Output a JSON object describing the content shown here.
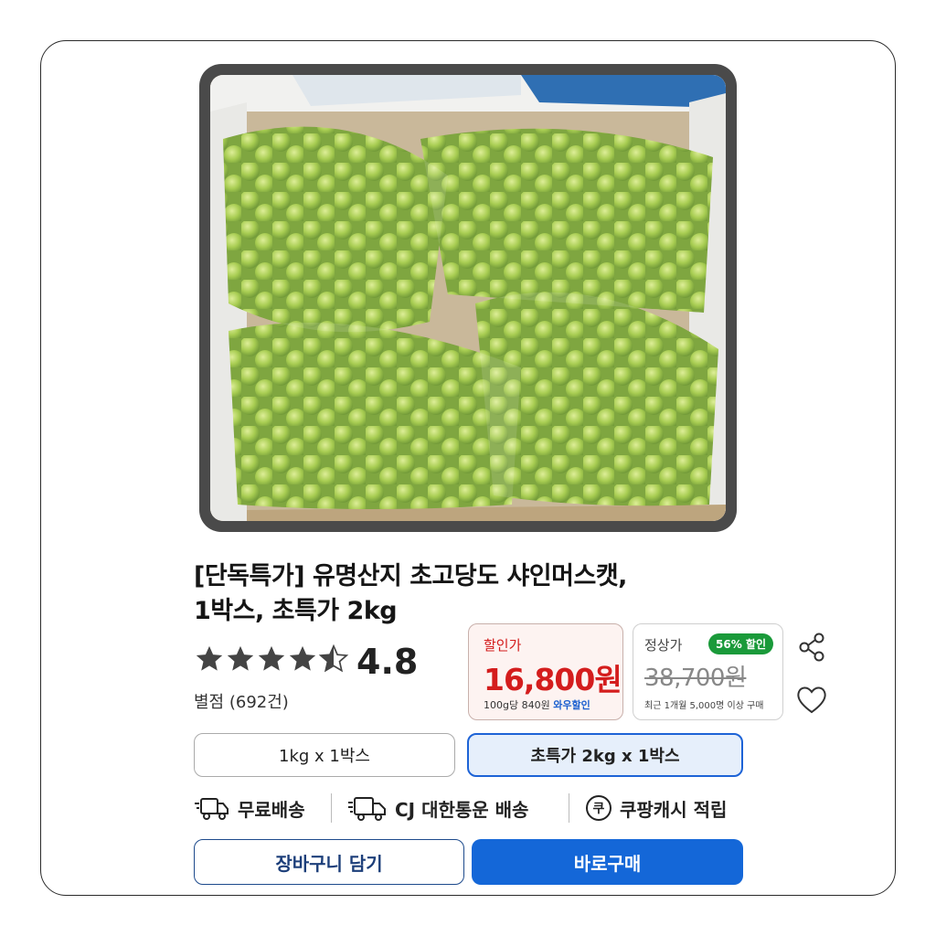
{
  "product": {
    "image_alt": "샤인머스캣 포도 박스",
    "title_line1": "[단독특가] 유명산지 초고당도 샤인머스캣,",
    "title_line2": "1박스, 초특가 2kg"
  },
  "rating": {
    "value": "4.8",
    "stars": 4.5,
    "review_count": "별점 (692건)"
  },
  "price": {
    "label": "할인가",
    "value": "16,800원",
    "unit_price": "100g당 840원",
    "wow": "와우할인",
    "accent_color": "#d41d1d"
  },
  "regular": {
    "label": "정상가",
    "badge": "56% 할인",
    "value": "38,700원",
    "note": "최근 1개월 5,000명 이상 구매",
    "badge_color": "#1a9a3a"
  },
  "actions_side": {
    "share_icon": "share-icon",
    "heart_icon": "heart-icon"
  },
  "options": [
    {
      "label": "1kg x 1박스",
      "selected": false
    },
    {
      "label": "초특가 2kg x 1박스",
      "selected": true
    }
  ],
  "shipping": {
    "free": "무료배송",
    "carrier": "CJ 대한통운 배송",
    "cash": "쿠팡캐시 적립",
    "cash_icon_glyph": "쿠"
  },
  "buttons": {
    "cart": "장바구니 담기",
    "buy": "바로구매",
    "primary_color": "#1467d8"
  }
}
